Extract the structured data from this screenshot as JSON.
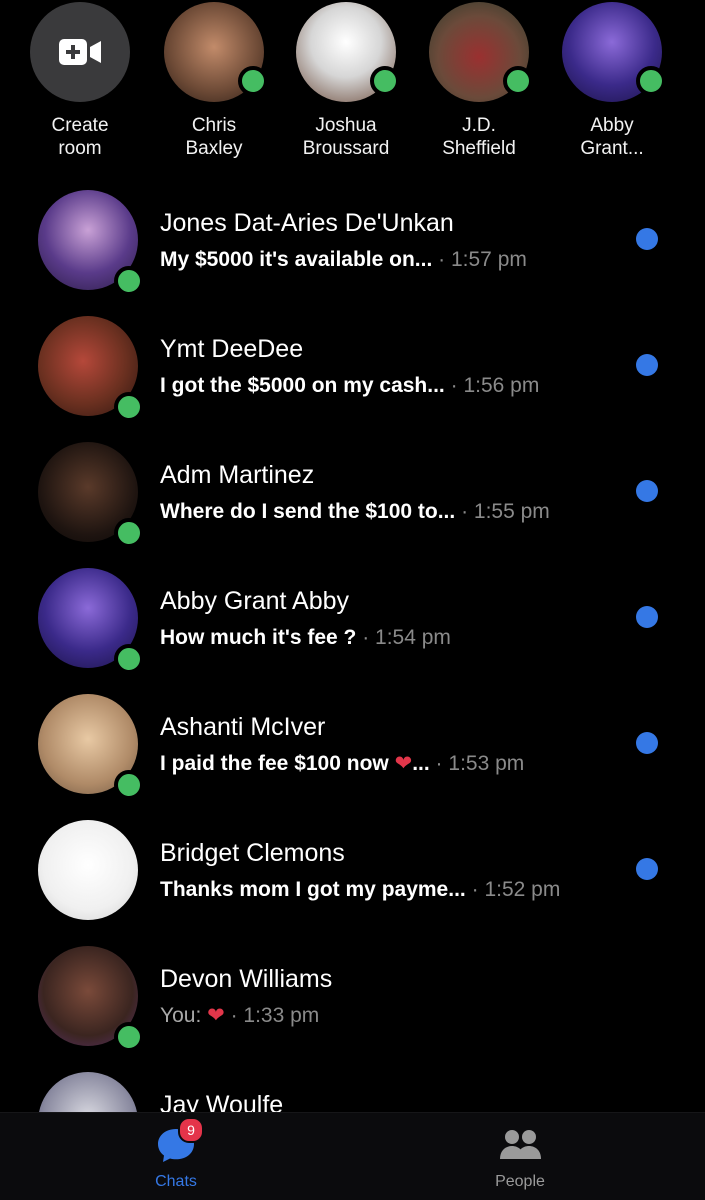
{
  "active_strip": {
    "create_room": {
      "label": "Create\nroom",
      "icon": "video-plus-icon"
    },
    "contacts": [
      {
        "label": "Chris\nBaxley",
        "online": true
      },
      {
        "label": "Joshua\nBroussard",
        "online": true
      },
      {
        "label": "J.D.\nSheffield",
        "online": true
      },
      {
        "label": "Abby\nGrant...",
        "online": true
      }
    ]
  },
  "chats": [
    {
      "name": "Jones Dat-Aries De'Unkan",
      "message": "My $5000 it's available on...",
      "time": "1:57 pm",
      "unread": true,
      "online": true
    },
    {
      "name": "Ymt DeeDee",
      "message": "I got the $5000 on my cash...",
      "time": "1:56 pm",
      "unread": true,
      "online": true
    },
    {
      "name": "Adm Martinez",
      "message": "Where do I send the $100 to...",
      "time": "1:55 pm",
      "unread": true,
      "online": true
    },
    {
      "name": "Abby Grant Abby",
      "message": "How much it's fee ?",
      "time": "1:54 pm",
      "unread": true,
      "online": true
    },
    {
      "name": "Ashanti McIver",
      "message": "I paid the fee  $100 now",
      "message_suffix": "...",
      "emoji": "❤",
      "time": "1:53 pm",
      "unread": true,
      "online": true
    },
    {
      "name": "Bridget Clemons",
      "message": "Thanks mom I got my payme...",
      "time": "1:52 pm",
      "unread": true,
      "online": false
    },
    {
      "name": "Devon Williams",
      "message": "You:",
      "emoji": "❤",
      "time": "1:33 pm",
      "unread": false,
      "online": true
    },
    {
      "name": "Jay Woulfe",
      "message": "",
      "time": "",
      "unread": false,
      "online": false
    }
  ],
  "separator": "·",
  "bottom_nav": {
    "chats": {
      "label": "Chats",
      "badge": "9",
      "icon": "chat-bubble-icon"
    },
    "people": {
      "label": "People",
      "icon": "people-icon"
    }
  },
  "colors": {
    "background": "#000000",
    "unread_dot": "#3578e5",
    "online_dot": "#45bd62",
    "active_tab": "#3578e5",
    "badge": "#e4344a"
  }
}
